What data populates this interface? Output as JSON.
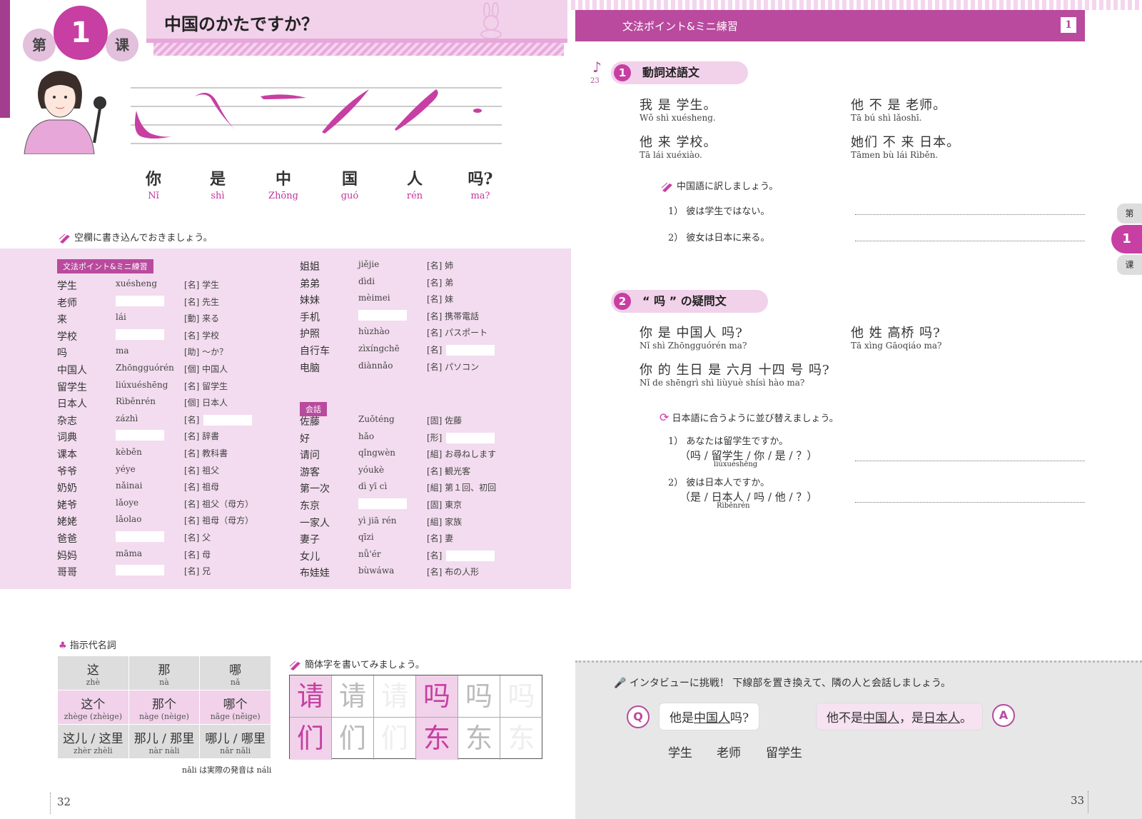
{
  "left_page": {
    "lesson_badge": {
      "left": "第",
      "number": "1",
      "right": "课"
    },
    "title": "中国のかたですか？",
    "tone_words": [
      {
        "hanzi": "你",
        "pinyin": "Nǐ"
      },
      {
        "hanzi": "是",
        "pinyin": "shì"
      },
      {
        "hanzi": "中",
        "pinyin": "Zhōng"
      },
      {
        "hanzi": "国",
        "pinyin": "guó"
      },
      {
        "hanzi": "人",
        "pinyin": "rén"
      },
      {
        "hanzi": "吗?",
        "pinyin": "ma?"
      }
    ],
    "fill_instruction": "空欄に書き込んでおきましょう。",
    "vocab_tag1": "文法ポイント&ミニ練習",
    "vocab_tag2": "会話",
    "vocab_col1": [
      {
        "hanzi": "学生",
        "pinyin": "xuésheng",
        "meaning": "[名] 学生"
      },
      {
        "hanzi": "老师",
        "pinyin": "",
        "meaning": "[名] 先生"
      },
      {
        "hanzi": "来",
        "pinyin": "lái",
        "meaning": "[動] 来る"
      },
      {
        "hanzi": "学校",
        "pinyin": "",
        "meaning": "[名] 学校"
      },
      {
        "hanzi": "吗",
        "pinyin": "ma",
        "meaning": "[助] ～か？"
      },
      {
        "hanzi": "中国人",
        "pinyin": "Zhōngguórén",
        "meaning": "[個] 中国人"
      },
      {
        "hanzi": "留学生",
        "pinyin": "liúxuéshēng",
        "meaning": "[名] 留学生"
      },
      {
        "hanzi": "日本人",
        "pinyin": "Rìběnrén",
        "meaning": "[個] 日本人"
      },
      {
        "hanzi": "杂志",
        "pinyin": "zázhì",
        "meaning": "[名]"
      },
      {
        "hanzi": "词典",
        "pinyin": "",
        "meaning": "[名] 辞書"
      },
      {
        "hanzi": "课本",
        "pinyin": "kèběn",
        "meaning": "[名] 教科書"
      },
      {
        "hanzi": "爷爷",
        "pinyin": "yéye",
        "meaning": "[名] 祖父"
      },
      {
        "hanzi": "奶奶",
        "pinyin": "nǎinai",
        "meaning": "[名] 祖母"
      },
      {
        "hanzi": "姥爷",
        "pinyin": "lǎoye",
        "meaning": "[名] 祖父（母方）"
      },
      {
        "hanzi": "姥姥",
        "pinyin": "lǎolao",
        "meaning": "[名] 祖母（母方）"
      },
      {
        "hanzi": "爸爸",
        "pinyin": "",
        "meaning": "[名] 父"
      },
      {
        "hanzi": "妈妈",
        "pinyin": "māma",
        "meaning": "[名] 母"
      },
      {
        "hanzi": "哥哥",
        "pinyin": "",
        "meaning": "[名] 兄"
      }
    ],
    "vocab_col2a": [
      {
        "hanzi": "姐姐",
        "pinyin": "jiějie",
        "meaning": "[名] 姉"
      },
      {
        "hanzi": "弟弟",
        "pinyin": "dìdi",
        "meaning": "[名] 弟"
      },
      {
        "hanzi": "妹妹",
        "pinyin": "mèimei",
        "meaning": "[名] 妹"
      },
      {
        "hanzi": "手机",
        "pinyin": "",
        "meaning": "[名] 携帯電話"
      },
      {
        "hanzi": "护照",
        "pinyin": "hùzhào",
        "meaning": "[名] パスポート"
      },
      {
        "hanzi": "自行车",
        "pinyin": "zìxíngchē",
        "meaning": "[名]"
      },
      {
        "hanzi": "电脑",
        "pinyin": "diànnǎo",
        "meaning": "[名] パソコン"
      }
    ],
    "vocab_col2b": [
      {
        "hanzi": "佐藤",
        "pinyin": "Zuǒténg",
        "meaning": "[固] 佐藤"
      },
      {
        "hanzi": "好",
        "pinyin": "hǎo",
        "meaning": "[形]"
      },
      {
        "hanzi": "请问",
        "pinyin": "qǐngwèn",
        "meaning": "[組] お尋ねします"
      },
      {
        "hanzi": "游客",
        "pinyin": "yóukè",
        "meaning": "[名] 観光客"
      },
      {
        "hanzi": "第一次",
        "pinyin": "dì yī cì",
        "meaning": "[組] 第１回、初回"
      },
      {
        "hanzi": "东京",
        "pinyin": "",
        "meaning": "[固] 東京"
      },
      {
        "hanzi": "一家人",
        "pinyin": "yì jiā rén",
        "meaning": "[組] 家族"
      },
      {
        "hanzi": "妻子",
        "pinyin": "qīzi",
        "meaning": "[名] 妻"
      },
      {
        "hanzi": "女儿",
        "pinyin": "nǚ'ér",
        "meaning": "[名]"
      },
      {
        "hanzi": "布娃娃",
        "pinyin": "bùwáwa",
        "meaning": "[名] 布の人形"
      }
    ],
    "demonstratives_title": "指示代名詞",
    "demonstratives": [
      [
        {
          "h": "这",
          "p": "zhè"
        },
        {
          "h": "那",
          "p": "nà"
        },
        {
          "h": "哪",
          "p": "nǎ"
        }
      ],
      [
        {
          "h": "这个",
          "p": "zhège (zhèige)"
        },
        {
          "h": "那个",
          "p": "nàge (nèige)"
        },
        {
          "h": "哪个",
          "p": "nǎge (něige)"
        }
      ],
      [
        {
          "h": "这儿 / 这里",
          "p": "zhèr      zhèli"
        },
        {
          "h": "那儿 / 那里",
          "p": "nàr      nàli"
        },
        {
          "h": "哪儿 / 哪里",
          "p": "nǎr      nǎli"
        }
      ]
    ],
    "demonstratives_note": "nǎli は実際の発音は náli",
    "writing_title": "簡体字を書いてみましょう。",
    "writing_chars": [
      "请",
      "吗",
      "们",
      "东"
    ],
    "page_number": "32"
  },
  "right_page": {
    "banner_title": "文法ポイント&ミニ練習",
    "banner_num": "1",
    "track": "23",
    "section1": {
      "num": "1",
      "title": "動詞述語文",
      "sentences": [
        {
          "h": "我 是 学生。",
          "p": "Wǒ  shì  xuésheng."
        },
        {
          "h": "他 不 是 老师。",
          "p": "Tā  bú  shì  lǎoshī."
        },
        {
          "h": "他 来 学校。",
          "p": "Tā  lái  xuéxiào."
        },
        {
          "h": "她们 不 来 日本。",
          "p": "Tāmen  bù  lái  Rìběn."
        }
      ],
      "exercise_title": "中国語に訳しましょう。",
      "exercises": [
        "1） 彼は学生ではない。",
        "2） 彼女は日本に来る。"
      ]
    },
    "section2": {
      "num": "2",
      "title": "“ 吗 ” の疑問文",
      "sentences": [
        {
          "h": "你 是  中国人  吗?",
          "p": "Nǐ  shì  Zhōngguórén  ma?"
        },
        {
          "h": "他 姓  高桥  吗?",
          "p": "Tā  xìng  Gāoqiáo  ma?"
        },
        {
          "h": "你 的  生日  是 六月  十四  号 吗?",
          "p": "Nǐ  de  shēngrì  shì  liùyuè  shísì  hào  ma?"
        }
      ],
      "exercise_title": "日本語に合うように並び替えましょう。",
      "exercises": [
        {
          "q": "1） あなたは留学生ですか。",
          "w": "（吗 / 留学生 / 你 / 是 / ？）",
          "r": "liúxuéshēng"
        },
        {
          "q": "2） 彼は日本人ですか。",
          "w": "（是 / 日本人 / 吗 / 他 / ？）",
          "r": "Rìběnrén"
        }
      ]
    },
    "side_tab": {
      "top": "第",
      "num": "1",
      "bottom": "课"
    },
    "interview": {
      "title": "インタビューに挑戦！ 下線部を置き換えて、隣の人と会話しましょう。",
      "q_icon": "Q",
      "a_icon": "A",
      "q_pre": "他是",
      "q_ul": "中国人",
      "q_post": "吗?",
      "a_pre": "他不是",
      "a_ul1": "中国人",
      "a_mid": "，是",
      "a_ul2": "日本人",
      "a_post": "。",
      "substitutes": [
        "学生",
        "老师",
        "留学生"
      ]
    },
    "page_number": "33"
  },
  "colors": {
    "accent": "#c73fa2",
    "banner": "#b94a9e",
    "light": "#f3dcef"
  },
  "icons": [
    "pencil-icon",
    "club-icon",
    "refresh-icon",
    "microphone-icon",
    "music-note-icon"
  ]
}
